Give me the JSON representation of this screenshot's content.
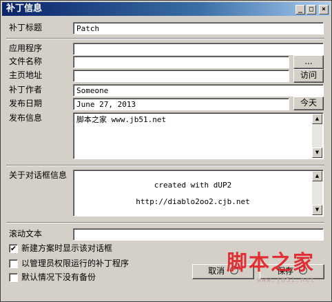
{
  "window": {
    "title": "补丁信息",
    "controls": {
      "minimize": "_",
      "maximize": "□",
      "close": "×"
    }
  },
  "fields": {
    "patch_title": {
      "label": "补丁标题",
      "value": "Patch"
    },
    "application": {
      "label": "应用程序",
      "value": ""
    },
    "file_name": {
      "label": "文件名称",
      "value": "",
      "browse_label": "..."
    },
    "homepage": {
      "label": "主页地址",
      "value": "",
      "visit_label": "访问"
    },
    "author": {
      "label": "补丁作者",
      "value": "Someone"
    },
    "release_date": {
      "label": "发布日期",
      "value": "June 27, 2013",
      "today_label": "今天"
    },
    "release_info": {
      "label": "发布信息",
      "value": "脚本之家 www.jb51.net"
    },
    "about_info": {
      "label": "关于对话框信息",
      "line1": "created with dUP2",
      "line2": "http://diablo2oo2.cjb.net"
    },
    "scroll_text": {
      "label": "滚动文本",
      "value": ""
    }
  },
  "options": [
    {
      "label": "新建方案时显示该对话框",
      "checked": true
    },
    {
      "label": "以管理员权限运行的补丁程序",
      "checked": false
    },
    {
      "label": "默认情况下没有备份",
      "checked": false
    }
  ],
  "buttons": {
    "cancel": "取消",
    "save": "保存"
  },
  "watermark": {
    "text": "脚本之家",
    "url": "www.jb51.net"
  },
  "check_mark": "✔"
}
